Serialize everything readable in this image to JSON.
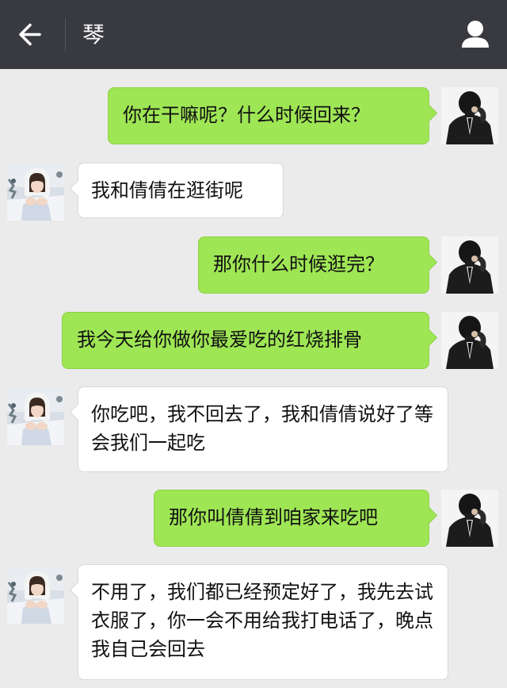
{
  "header": {
    "title": "琴",
    "back_icon": "back-arrow-icon",
    "profile_icon": "person-icon"
  },
  "messages": [
    {
      "side": "right",
      "text": "你在干嘛呢？什么时候回来？"
    },
    {
      "side": "left",
      "text": "我和倩倩在逛街呢"
    },
    {
      "side": "right",
      "text": "那你什么时候逛完？"
    },
    {
      "side": "right",
      "text": "我今天给你做你最爱吃的红烧排骨"
    },
    {
      "side": "left",
      "text": "你吃吧，我不回去了，我和倩倩说好了等会我们一起吃"
    },
    {
      "side": "right",
      "text": "那你叫倩倩到咱家来吃吧"
    },
    {
      "side": "left",
      "text": "不用了，我们都已经预定好了，我先去试衣服了，你一会不用给我打电话了，晚点我自己会回去"
    }
  ],
  "colors": {
    "header_bg": "#393a3f",
    "chat_bg": "#ebebeb",
    "sent_bubble": "#9fe655",
    "received_bubble": "#ffffff"
  }
}
